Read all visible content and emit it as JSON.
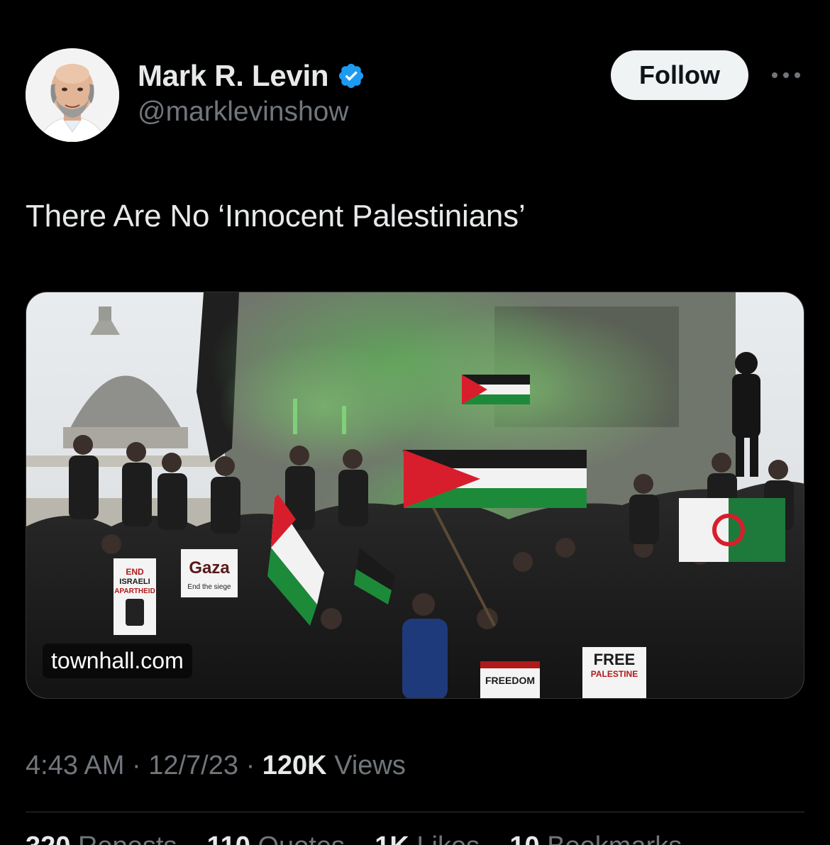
{
  "author": {
    "display_name": "Mark R. Levin",
    "handle": "@marklevinshow",
    "verified": true,
    "avatar_icon": "profile-photo"
  },
  "actions": {
    "follow_label": "Follow",
    "more_icon": "more-horizontal-icon"
  },
  "tweet": {
    "text": "There Are No ‘Innocent Palestinians’"
  },
  "link_card": {
    "domain": "townhall.com",
    "image_signs": {
      "gaza_sign": "Gaza",
      "gaza_subtitle": "End the siege",
      "apartheid_sign_line1": "END",
      "apartheid_sign_line2": "ISRAELI",
      "apartheid_sign_line3": "APARTHEID",
      "free_sign_line1": "FREE",
      "free_sign_line2": "PALESTINE",
      "freedom_sign": "FREEDOM"
    }
  },
  "meta": {
    "time": "4:43 AM",
    "separator": "·",
    "date": "12/7/23",
    "views_count": "120K",
    "views_label": "Views"
  },
  "stats_row_partial": {
    "reposts_count": "320",
    "reposts_label": "Reposts",
    "quotes_count": "110",
    "quotes_label": "Quotes",
    "likes_count": "1K",
    "likes_label": "Likes",
    "bookmarks_count": "10",
    "bookmarks_label": "Bookmarks"
  },
  "colors": {
    "background": "#000000",
    "primary_text": "#e7e9ea",
    "secondary_text": "#71767b",
    "verified_blue": "#1d9bf0",
    "follow_bg": "#eff3f4",
    "divider": "#2f3336"
  }
}
